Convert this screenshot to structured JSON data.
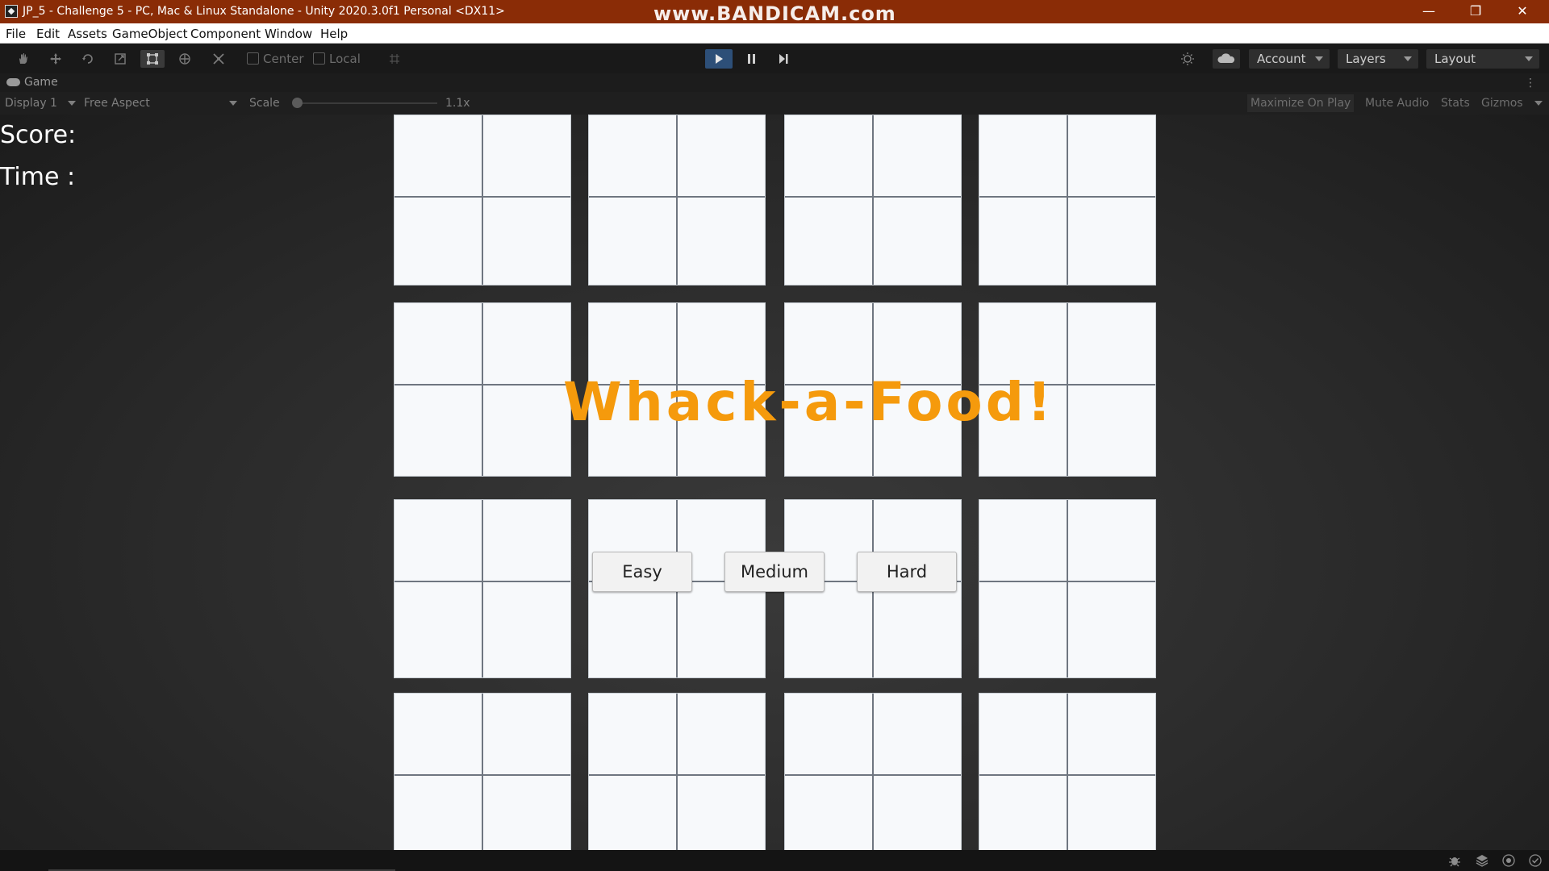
{
  "window": {
    "title": "JP_5 - Challenge 5 - PC, Mac & Linux Standalone - Unity 2020.3.0f1 Personal <DX11>",
    "watermark": "www.BANDICAM.com",
    "controls": {
      "minimize": "—",
      "restore": "❐",
      "close": "✕"
    }
  },
  "menu": [
    "File",
    "Edit",
    "Assets",
    "GameObject",
    "Component",
    "Window",
    "Help"
  ],
  "toolbar": {
    "tools": [
      "hand-icon",
      "move-icon",
      "rotate-icon",
      "scale-icon",
      "rect-icon",
      "transform-icon",
      "custom-tool-icon"
    ],
    "pivot_label": "Center",
    "space_label": "Local",
    "account_label": "Account",
    "layers_label": "Layers",
    "layout_label": "Layout",
    "play_active_color": "#2d4f78"
  },
  "tab": {
    "label": "Game",
    "kebab": "⋮"
  },
  "gamebar": {
    "display": "Display 1",
    "aspect": "Free Aspect",
    "scale_label": "Scale",
    "scale_value": "1.1x",
    "scale_level": 0,
    "maximize": "Maximize On Play",
    "mute": "Mute Audio",
    "stats": "Stats",
    "gizmos": "Gizmos"
  },
  "game": {
    "score_label": "Score:",
    "time_label": "Time :",
    "title": "Whack-a-Food!",
    "title_color": "#f59a0c",
    "difficulty_buttons": [
      "Easy",
      "Medium",
      "Hard"
    ]
  }
}
